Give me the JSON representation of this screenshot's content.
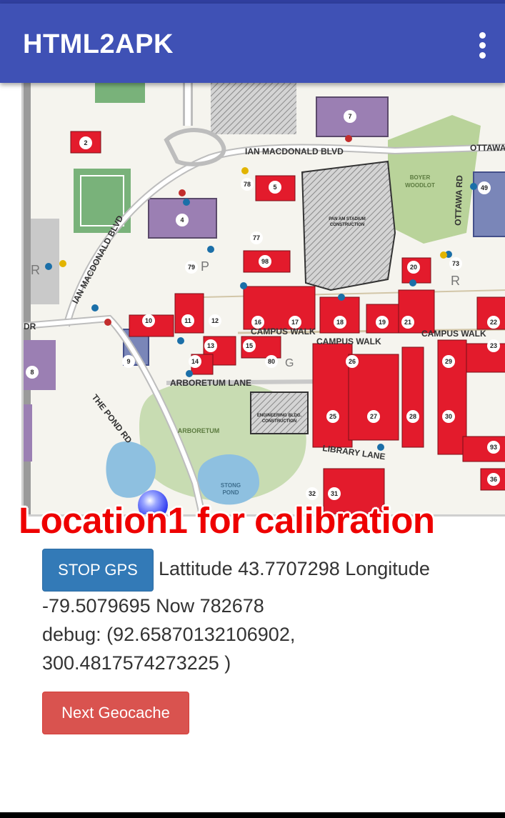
{
  "app_bar": {
    "title": "HTML2APK",
    "menu_icon": "overflow-menu-icon"
  },
  "map": {
    "road_labels": {
      "ian_macdonald_top": "IAN MACDONALD BLVD",
      "ian_macdonald_side": "IAN MACDONALD BLVD",
      "pond_road": "THE POND RD",
      "arboretum_lane": "ARBORETUM LANE",
      "campus_walk_1": "CAMPUS WALK",
      "campus_walk_2": "CAMPUS WALK",
      "campus_walk_3": "CAMPUS WALK",
      "library_lane": "LIBRARY LANE",
      "ottawa_top": "OTTAWA",
      "ottawa_side": "OTTAWA RD",
      "dr": "DR"
    },
    "area_labels": {
      "boyer": "BOYER",
      "woodlot": "WOODLOT",
      "arboretum": "ARBORETUM",
      "stong": "STONG",
      "pond": "POND",
      "stadium_1": "PAN AM STADIUM",
      "stadium_2": "CONSTRUCTION",
      "eng_1": "ENGINEERING BLDG.",
      "eng_2": "CONSTRUCTION"
    },
    "building_numbers": [
      "2",
      "4",
      "5",
      "7",
      "8",
      "9",
      "10",
      "11",
      "12",
      "13",
      "14",
      "15",
      "16",
      "17",
      "18",
      "19",
      "20",
      "21",
      "22",
      "23",
      "25",
      "26",
      "27",
      "28",
      "29",
      "30",
      "31",
      "32",
      "36",
      "49",
      "73",
      "77",
      "78",
      "79",
      "80",
      "93",
      "98"
    ],
    "letters": {
      "r1": "R",
      "r2": "R",
      "p": "P",
      "g": "G"
    }
  },
  "overlay": {
    "caption": "Location1 for calibration"
  },
  "gps": {
    "button_label": "STOP GPS",
    "line1": "Lattitude 43.7707298 Longitude",
    "line2": "-79.5079695 Now 782678",
    "line3": "debug: (92.65870132106902,",
    "line4": "300.4817574273225 )"
  },
  "next_button": {
    "label": "Next Geocache"
  },
  "colors": {
    "app_bar": "#3f51b5",
    "building": "#e31b2c",
    "stop_button": "#337ab7",
    "next_button": "#d9534f",
    "caption": "#ee0000"
  }
}
